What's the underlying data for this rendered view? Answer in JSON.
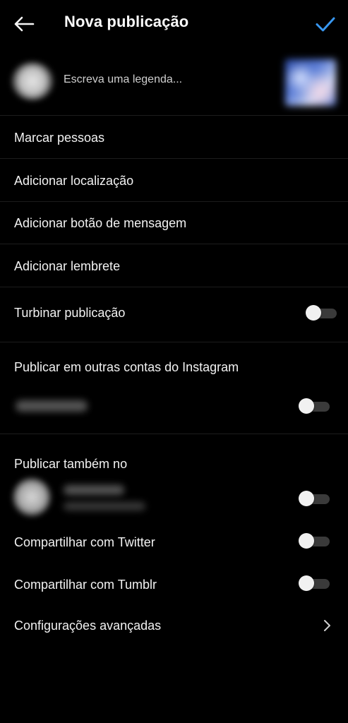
{
  "header": {
    "title": "Nova publicação",
    "back_icon": "arrow-left-icon",
    "confirm_icon": "check-icon",
    "confirm_color": "#3897f0"
  },
  "caption": {
    "placeholder": "Escreva uma legenda...",
    "value": ""
  },
  "menu": {
    "tag_people": "Marcar pessoas",
    "add_location": "Adicionar localização",
    "add_message_button": "Adicionar botão de mensagem",
    "add_reminder": "Adicionar lembrete",
    "boost_post": "Turbinar publicação"
  },
  "toggles": {
    "boost_post": false,
    "other_account": false,
    "facebook": false,
    "twitter": false,
    "tumblr": false
  },
  "share": {
    "other_accounts_title": "Publicar em outras contas do Instagram",
    "also_post_title": "Publicar também no",
    "twitter_label": "Compartilhar com Twitter",
    "tumblr_label": "Compartilhar com Tumblr",
    "advanced_settings": "Configurações avançadas"
  },
  "colors": {
    "background": "#000000",
    "divider": "#1c1c1c",
    "text": "#f2f2f2",
    "toggle_track": "#3a3a3a",
    "toggle_knob": "#f1f1f1"
  }
}
